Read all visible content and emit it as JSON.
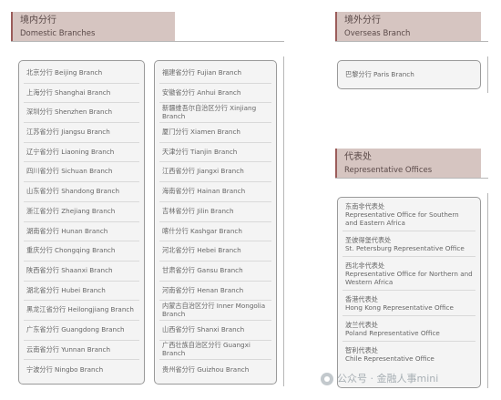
{
  "domestic": {
    "title_zh": "境内分行",
    "title_en": "Domestic Branches",
    "col1": [
      "北京分行 Beijing Branch",
      "上海分行 Shanghai Branch",
      "深圳分行 Shenzhen Branch",
      "江苏省分行 Jiangsu Branch",
      "辽宁省分行 Liaoning Branch",
      "四川省分行 Sichuan Branch",
      "山东省分行 Shandong Branch",
      "浙江省分行 Zhejiang Branch",
      "湖南省分行 Hunan Branch",
      "重庆分行 Chongqing Branch",
      "陕西省分行 Shaanxi Branch",
      "湖北省分行 Hubei Branch",
      "黑龙江省分行 Heilongjiang Branch",
      "广东省分行 Guangdong Branch",
      "云南省分行 Yunnan Branch",
      "宁波分行 Ningbo Branch"
    ],
    "col2": [
      "福建省分行 Fujian Branch",
      "安徽省分行 Anhui Branch",
      "新疆维吾尔自治区分行 Xinjiang Branch",
      "厦门分行 Xiamen Branch",
      "天津分行 Tianjin Branch",
      "江西省分行 Jiangxi Branch",
      "海南省分行 Hainan Branch",
      "吉林省分行 Jilin Branch",
      "喀什分行 Kashgar Branch",
      "河北省分行 Hebei Branch",
      "甘肃省分行 Gansu Branch",
      "河南省分行 Henan Branch",
      "内蒙古自治区分行 Inner Mongolia Branch",
      "山西省分行 Shanxi Branch",
      "广西壮族自治区分行 Guangxi Branch",
      "贵州省分行 Guizhou Branch"
    ]
  },
  "overseas": {
    "title_zh": "境外分行",
    "title_en": "Overseas Branch",
    "items": [
      "巴黎分行 Paris Branch"
    ]
  },
  "rep": {
    "title_zh": "代表处",
    "title_en": "Representative Offices",
    "items": [
      {
        "zh": "东南非代表处",
        "en": "Representative Office for Southern and Eastern Africa"
      },
      {
        "zh": "圣彼得堡代表处",
        "en": "St. Petersburg Representative Office"
      },
      {
        "zh": "西北非代表处",
        "en": "Representative Office for Northern and Western Africa"
      },
      {
        "zh": "香港代表处",
        "en": "Hong Kong Representative Office"
      },
      {
        "zh": "波兰代表处",
        "en": "Poland Representative Office"
      },
      {
        "zh": "智利代表处",
        "en": "Chile Representative Office"
      }
    ]
  },
  "watermark": "公众号 · 金融人事mini"
}
